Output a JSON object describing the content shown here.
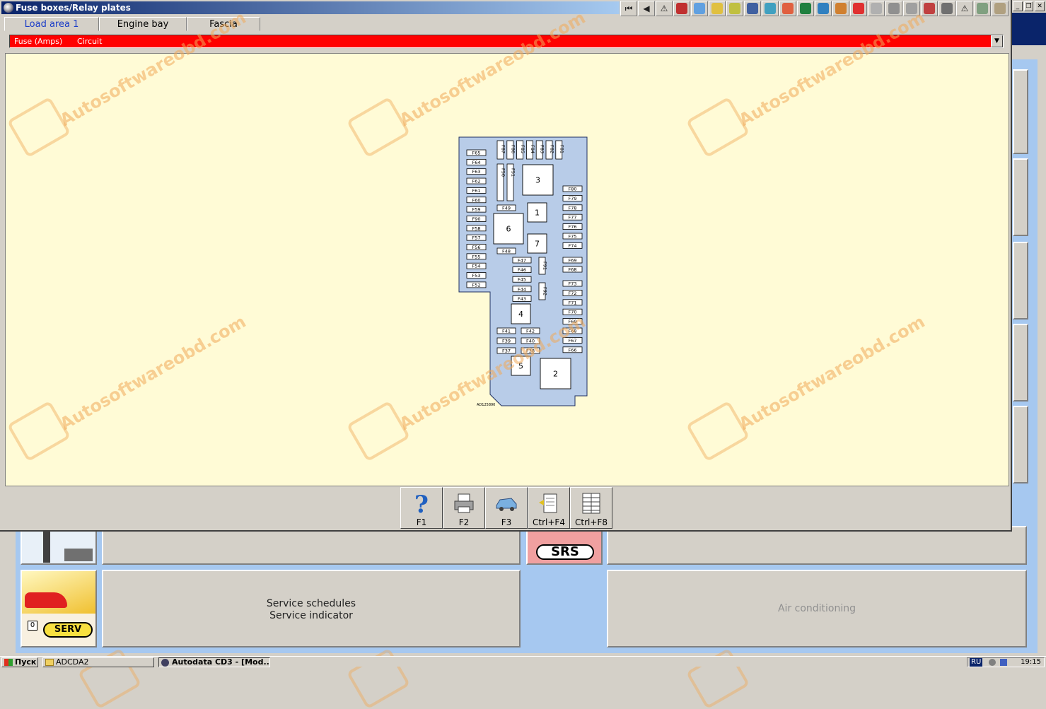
{
  "window": {
    "title": "Fuse boxes/Relay plates",
    "controls": [
      "_",
      "❐",
      "✕"
    ]
  },
  "tabs": [
    {
      "label": "Load area 1",
      "active": true
    },
    {
      "label": "Engine bay",
      "active": false
    },
    {
      "label": "Fascia",
      "active": false
    }
  ],
  "header_bar": {
    "col1": "Fuse (Amps)",
    "col2": "Circuit",
    "color": "#ff0000"
  },
  "function_keys": [
    {
      "label": "F1",
      "icon": "help-icon"
    },
    {
      "label": "F2",
      "icon": "printer-icon"
    },
    {
      "label": "F3",
      "icon": "car-icon"
    },
    {
      "label": "Ctrl+F4",
      "icon": "note-icon"
    },
    {
      "label": "Ctrl+F8",
      "icon": "table-icon"
    }
  ],
  "diagram": {
    "fuses_left": [
      "F65",
      "F64",
      "F63",
      "F62",
      "F61",
      "F60",
      "F59",
      "F90",
      "F58",
      "F57",
      "F56",
      "F55",
      "F54",
      "F53",
      "F52"
    ],
    "fuses_top": [
      "F87",
      "F86",
      "F85",
      "F84",
      "F83",
      "F82",
      "F81"
    ],
    "fuses_right_a": [
      "F80",
      "F79",
      "F78",
      "F77",
      "F76",
      "F75",
      "F74"
    ],
    "fuses_right_b": [
      "F69",
      "F68"
    ],
    "fuses_right_c": [
      "F73",
      "F72",
      "F71",
      "F70",
      "F69",
      "F68",
      "F67",
      "F66"
    ],
    "fuses_mid": [
      "F47",
      "F46",
      "F45",
      "F44",
      "F43"
    ],
    "fuses_vert_mid": [
      "F50",
      "F51"
    ],
    "fuses_small_v": [
      "F91",
      "F92"
    ],
    "fuses_bottom_pairs": [
      [
        "F41",
        "F42"
      ],
      [
        "F39",
        "F40"
      ],
      [
        "F37",
        "F38"
      ]
    ],
    "f49": "F49",
    "f48": "F48",
    "relays": [
      "1",
      "2",
      "3",
      "4",
      "5",
      "6",
      "7"
    ],
    "ref_code": "AD125890"
  },
  "watermark": "Autosoftwareobd.com",
  "background_panels": {
    "service_line1": "Service schedules",
    "service_line2": "Service indicator",
    "srs_label": "SRS",
    "serv_label": "SERV",
    "aircon": "Air conditioning"
  },
  "taskbar": {
    "start": "Пуск",
    "task1": "ADCDA2",
    "task2": "Autodata CD3 - [Mod...",
    "lang": "RU",
    "time": "19:15"
  }
}
